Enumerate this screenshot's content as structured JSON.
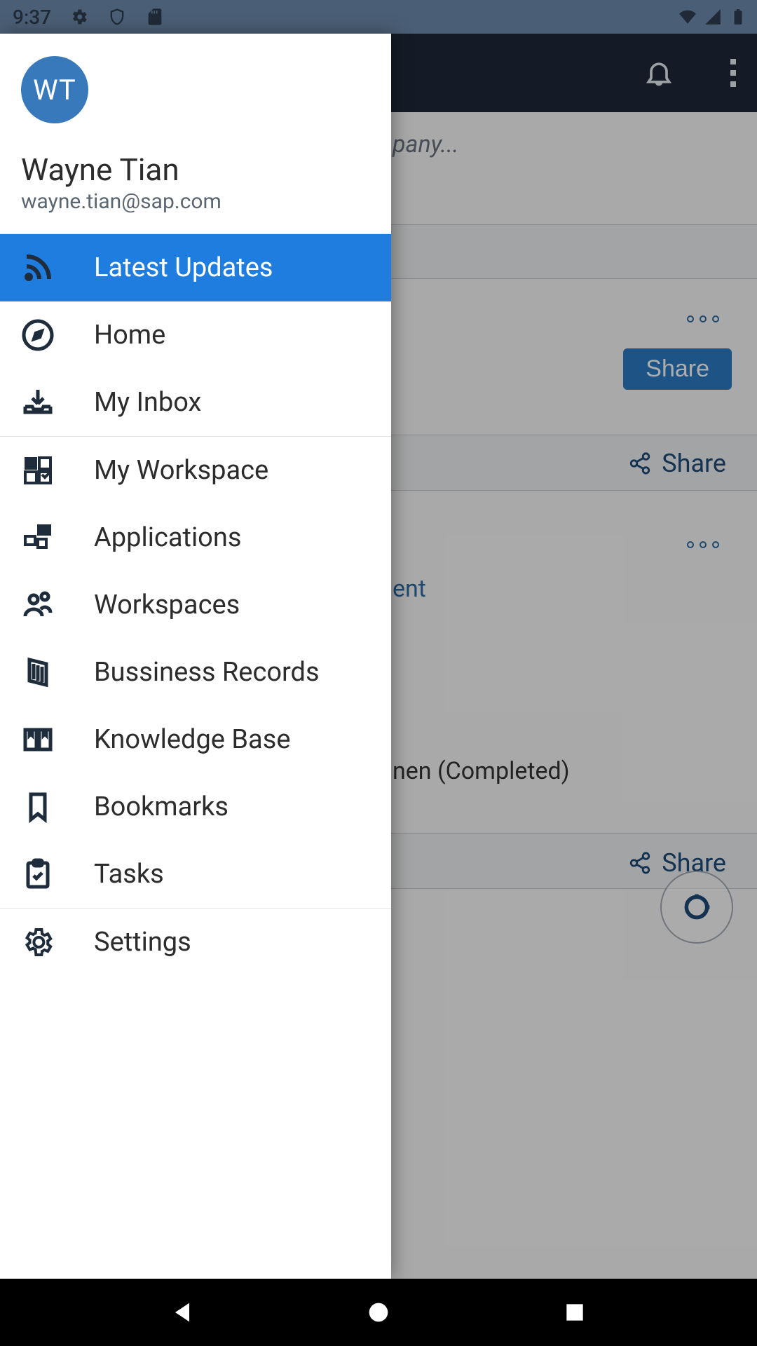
{
  "status": {
    "time": "9:37"
  },
  "header": {
    "hint_text": "pany..."
  },
  "profile": {
    "initials": "WT",
    "name": "Wayne Tian",
    "email": "wayne.tian@sap.com"
  },
  "nav": {
    "latest_updates": "Latest Updates",
    "home": "Home",
    "my_inbox": "My Inbox",
    "my_workspace": "My Workspace",
    "applications": "Applications",
    "workspaces": "Workspaces",
    "business_records": "Bussiness Records",
    "knowledge_base": "Knowledge Base",
    "bookmarks": "Bookmarks",
    "tasks": "Tasks",
    "settings": "Settings"
  },
  "feed": {
    "share_button": "Share",
    "share_link": "Share",
    "frag_text_1": "ent",
    "frag_text_2": "nen (Completed)"
  }
}
